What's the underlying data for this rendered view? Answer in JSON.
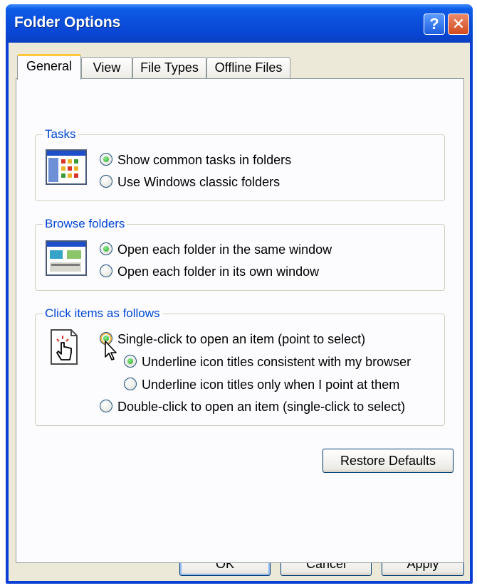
{
  "window": {
    "title": "Folder Options",
    "help_glyph": "?",
    "close_glyph": "✕"
  },
  "tabs": [
    {
      "label": "General",
      "active": true
    },
    {
      "label": "View",
      "active": false
    },
    {
      "label": "File Types",
      "active": false
    },
    {
      "label": "Offline Files",
      "active": false
    }
  ],
  "tasks": {
    "title": "Tasks",
    "icon": "task-pane-folder-icon",
    "options": [
      {
        "label": "Show common tasks in folders",
        "checked": true
      },
      {
        "label": "Use Windows classic folders",
        "checked": false
      }
    ]
  },
  "browse": {
    "title": "Browse folders",
    "icon": "same-window-folder-icon",
    "options": [
      {
        "label": "Open each folder in the same window",
        "checked": true
      },
      {
        "label": "Open each folder in its own window",
        "checked": false
      }
    ]
  },
  "click": {
    "title": "Click items as follows",
    "icon": "hand-pointer-click-icon",
    "options": [
      {
        "label": "Single-click to open an item (point to select)",
        "checked": true
      },
      {
        "label": "Underline icon titles consistent with my browser",
        "checked": true
      },
      {
        "label": "Underline icon titles only when I point at them",
        "checked": false
      },
      {
        "label": "Double-click to open an item (single-click to select)",
        "checked": false
      }
    ]
  },
  "buttons": {
    "restore": "Restore Defaults",
    "ok": "OK",
    "cancel": "Cancel",
    "apply": "Apply"
  },
  "colors": {
    "titlebar": "#0a4fdb",
    "group_title": "#0046d5",
    "dialog_bg": "#ece9d8",
    "tab_highlight": "#ffc83c"
  }
}
